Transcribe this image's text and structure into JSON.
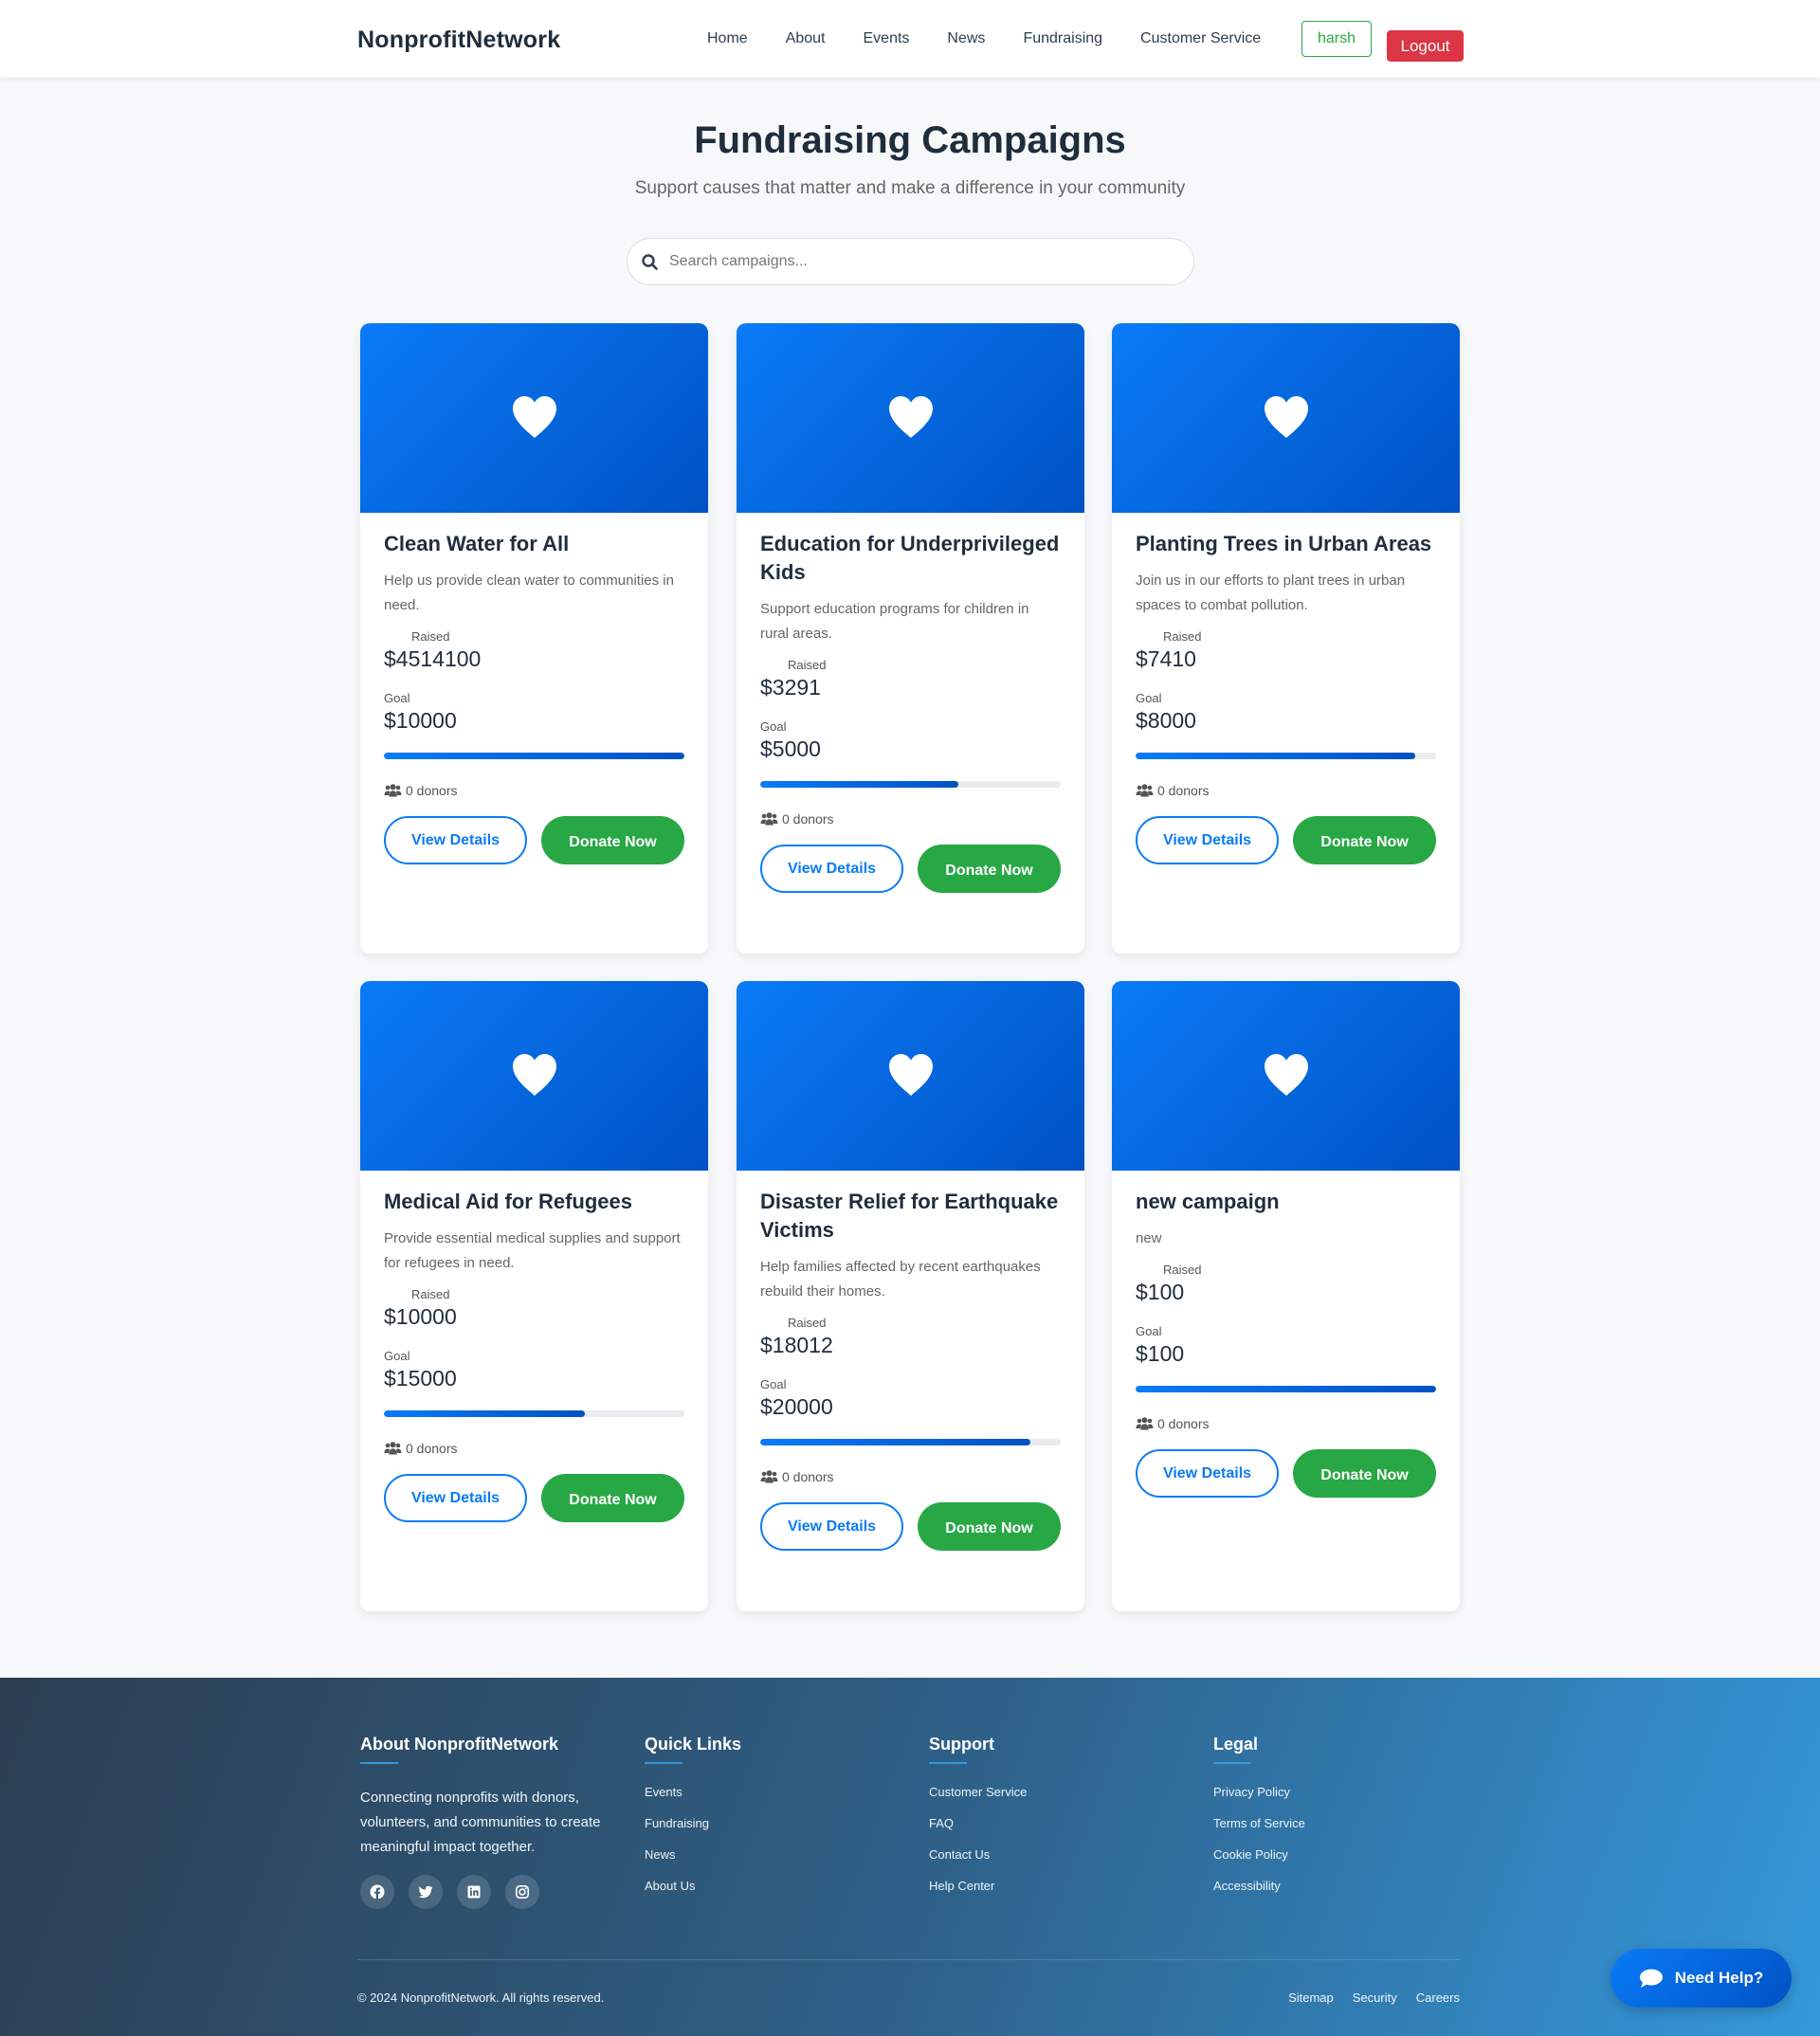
{
  "nav": {
    "brand": "NonprofitNetwork",
    "links": [
      "Home",
      "About",
      "Events",
      "News",
      "Fundraising",
      "Customer Service"
    ],
    "user": "harsh",
    "logout": "Logout"
  },
  "hero": {
    "title": "Fundraising Campaigns",
    "subtitle": "Support causes that matter and make a difference in your community"
  },
  "search": {
    "placeholder": "Search campaigns...",
    "value": ""
  },
  "labels": {
    "raised": "Raised",
    "goal": "Goal",
    "view_details": "View Details",
    "donate_now": "Donate Now"
  },
  "colors": {
    "primary": "#0a7bf7",
    "success": "#28a745",
    "danger": "#dc3545",
    "dark": "#2c3e50"
  },
  "campaigns": [
    {
      "title": "Clean Water for All",
      "description": "Help us provide clean water to communities in need.",
      "raised": "$4514100",
      "goal": "$10000",
      "progress": 1.0,
      "donors": "0 donors",
      "icon": "heart-icon"
    },
    {
      "title": "Education for Underprivileged Kids",
      "description": "Support education programs for children in rural areas.",
      "raised": "$3291",
      "goal": "$5000",
      "progress": 0.66,
      "donors": "0 donors",
      "icon": "heart-icon"
    },
    {
      "title": "Planting Trees in Urban Areas",
      "description": "Join us in our efforts to plant trees in urban spaces to combat pollution.",
      "raised": "$7410",
      "goal": "$8000",
      "progress": 0.93,
      "donors": "0 donors",
      "icon": "heart-icon"
    },
    {
      "title": "Medical Aid for Refugees",
      "description": "Provide essential medical supplies and support for refugees in need.",
      "raised": "$10000",
      "goal": "$15000",
      "progress": 0.67,
      "donors": "0 donors",
      "icon": "heart-icon"
    },
    {
      "title": "Disaster Relief for Earthquake Victims",
      "description": "Help families affected by recent earthquakes rebuild their homes.",
      "raised": "$18012",
      "goal": "$20000",
      "progress": 0.9,
      "donors": "0 donors",
      "icon": "heart-icon"
    },
    {
      "title": "new campaign",
      "description": "new",
      "raised": "$100",
      "goal": "$100",
      "progress": 1.0,
      "donors": "0 donors",
      "icon": "heart-icon"
    }
  ],
  "footer": {
    "about": {
      "heading": "About NonprofitNetwork",
      "text": "Connecting nonprofits with donors, volunteers, and communities to create meaningful impact together.",
      "socials": [
        "facebook-icon",
        "twitter-icon",
        "linkedin-icon",
        "instagram-icon"
      ]
    },
    "quick_links": {
      "heading": "Quick Links",
      "links": [
        "Events",
        "Fundraising",
        "News",
        "About Us"
      ]
    },
    "support": {
      "heading": "Support",
      "links": [
        "Customer Service",
        "FAQ",
        "Contact Us",
        "Help Center"
      ]
    },
    "legal": {
      "heading": "Legal",
      "links": [
        "Privacy Policy",
        "Terms of Service",
        "Cookie Policy",
        "Accessibility"
      ]
    },
    "copyright": "© 2024 NonprofitNetwork. All rights reserved.",
    "bottom_links": [
      "Sitemap",
      "Security",
      "Careers"
    ]
  },
  "help": {
    "label": "Need Help?"
  }
}
